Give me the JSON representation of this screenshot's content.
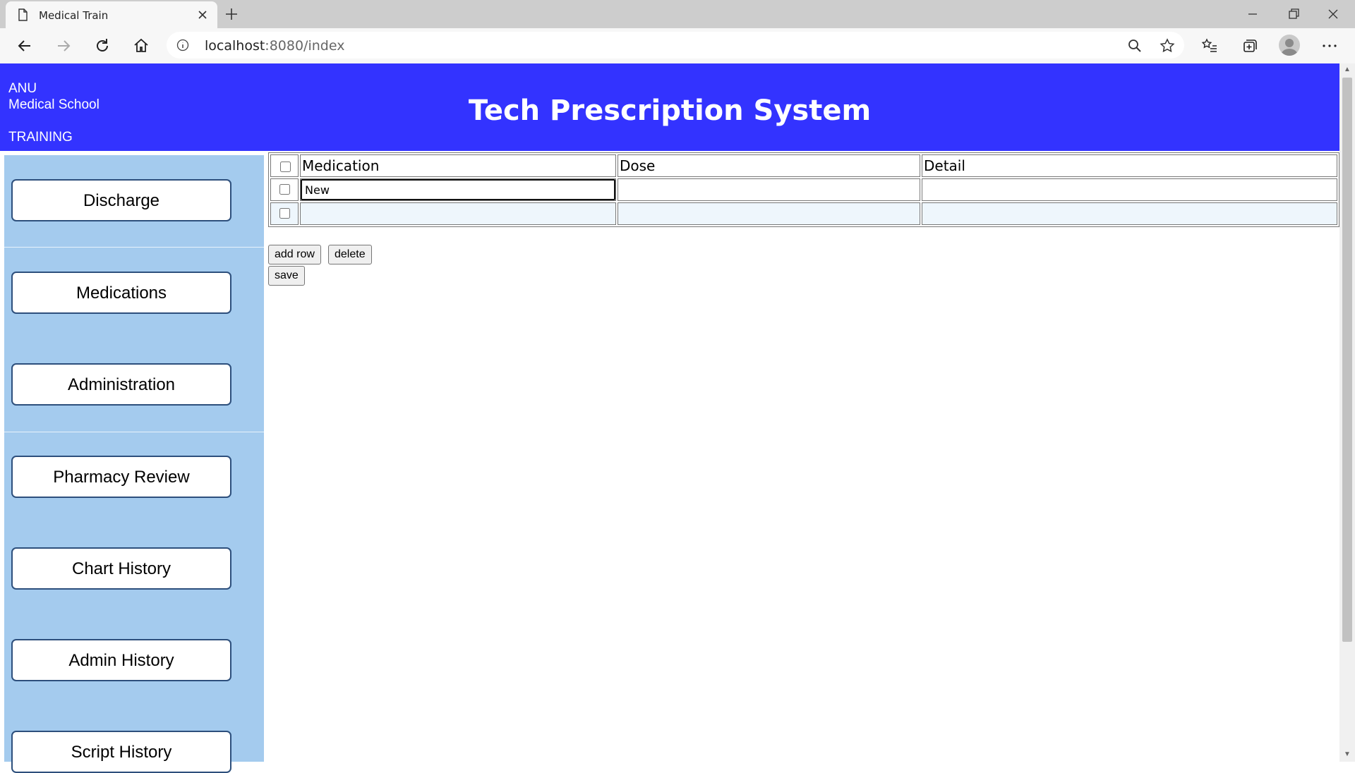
{
  "browser": {
    "tab_title": "Medical Train",
    "url_host": "localhost",
    "url_rest": ":8080/index"
  },
  "header": {
    "brand_line1": "ANU",
    "brand_line2": "Medical School",
    "training": "TRAINING",
    "title": "Tech Prescription System"
  },
  "sidebar": {
    "items": [
      {
        "label": "Discharge"
      },
      {
        "label": "Medications"
      },
      {
        "label": "Administration"
      },
      {
        "label": "Pharmacy Review"
      },
      {
        "label": "Chart History"
      },
      {
        "label": "Admin History"
      },
      {
        "label": "Script History"
      }
    ]
  },
  "table": {
    "columns": [
      "Medication",
      "Dose",
      "Detail"
    ],
    "rows": [
      {
        "medication": "New",
        "dose": "",
        "detail": ""
      },
      {
        "medication": "",
        "dose": "",
        "detail": ""
      }
    ]
  },
  "actions": {
    "add_row": "add row",
    "delete": "delete",
    "save": "save"
  },
  "colors": {
    "header_bg": "#3333ff",
    "sidebar_bg": "#a4cbee",
    "button_border": "#2d4f7c"
  }
}
